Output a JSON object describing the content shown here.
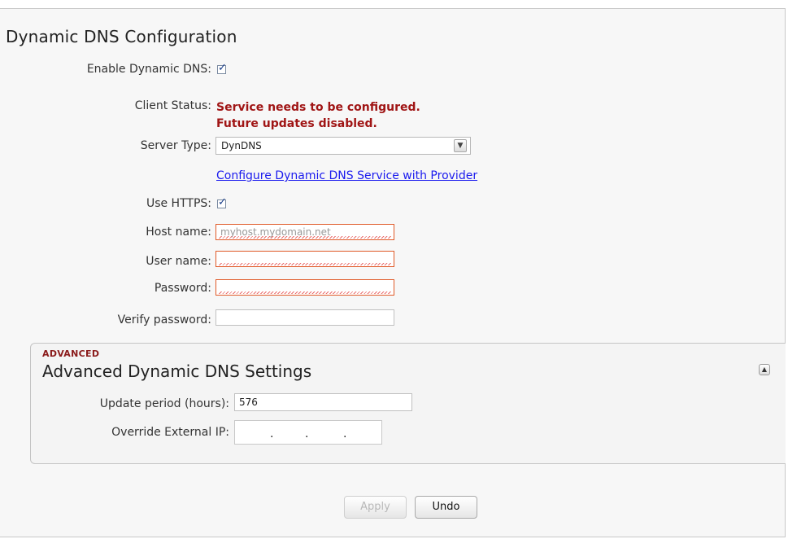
{
  "page": {
    "title": "Dynamic DNS Configuration"
  },
  "form": {
    "enable_label": "Enable Dynamic DNS:",
    "enable_checked": true,
    "status_label": "Client Status:",
    "status_lines": [
      "Service needs to be configured.",
      "Future updates disabled."
    ],
    "server_type_label": "Server Type:",
    "server_type_value": "DynDNS",
    "configure_link": "Configure Dynamic DNS Service with Provider",
    "https_label": "Use HTTPS:",
    "https_checked": true,
    "host_label": "Host name:",
    "host_placeholder": "myhost.mydomain.net",
    "user_label": "User name:",
    "user_value": "",
    "password_label": "Password:",
    "verify_label": "Verify password:"
  },
  "advanced": {
    "tag": "ADVANCED",
    "title": "Advanced Dynamic DNS Settings",
    "update_label": "Update period (hours):",
    "update_value": "576",
    "override_label": "Override External IP:",
    "ip_separator": "."
  },
  "actions": {
    "apply_label": "Apply",
    "undo_label": "Undo"
  },
  "icons": {
    "dropdown": "chevron-down-icon",
    "collapse": "chevron-up-icon",
    "check": "checkmark-icon"
  },
  "colors": {
    "status_error": "#a01515",
    "link": "#1a1aee",
    "field_error_border": "#e05a28",
    "advanced_tag": "#8a1a1a"
  }
}
